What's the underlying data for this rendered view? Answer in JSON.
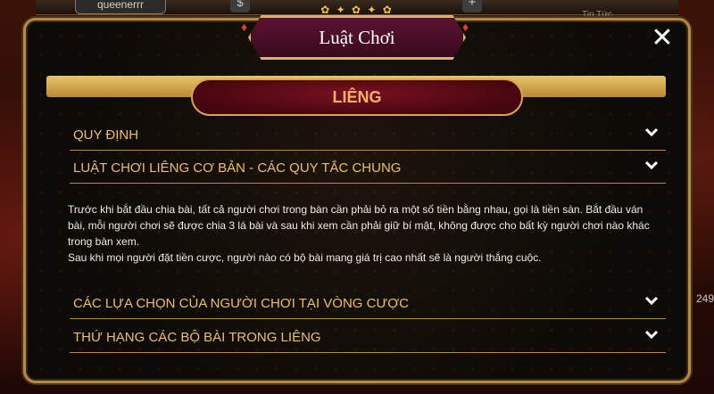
{
  "background": {
    "username": "queenerrr",
    "dollar_icon": "$",
    "plus_icon": "+",
    "news_label": "Tin Tức",
    "right_badge": "249"
  },
  "dialog": {
    "title": "Luật Chơi",
    "close_icon": "✕",
    "game_tab": "LIÊNG"
  },
  "sections": [
    {
      "label": "QUY ĐỊNH"
    },
    {
      "label": "LUẬT CHƠI LIÊNG CƠ BẢN - CÁC QUY TẮC CHUNG"
    },
    {
      "label": "CÁC LỰA CHỌN CỦA NGƯỜI CHƠI TẠI VÒNG CƯỢC"
    },
    {
      "label": "THỨ HẠNG CÁC BỘ BÀI TRONG LIÊNG"
    }
  ],
  "content": {
    "p1": "Trước khi bắt đầu chia bài, tất cả người chơi trong bàn cần phải bỏ ra một số tiền bằng nhau, gọi là tiền sàn. Bắt đầu ván bài, mỗi người chơi sẽ được chia 3 lá bài và sau khi xem cần phải giữ bí mật, không được cho bất kỳ người chơi nào khác trong bàn xem.",
    "p2": "Sau khi mọi người đặt tiền cược, người nào có bộ bài mang giá trị cao nhất sẽ là người thắng cuộc."
  },
  "colors": {
    "gold": "#e9c069",
    "frame": "#b58a46",
    "tab_red": "#7a1020"
  }
}
